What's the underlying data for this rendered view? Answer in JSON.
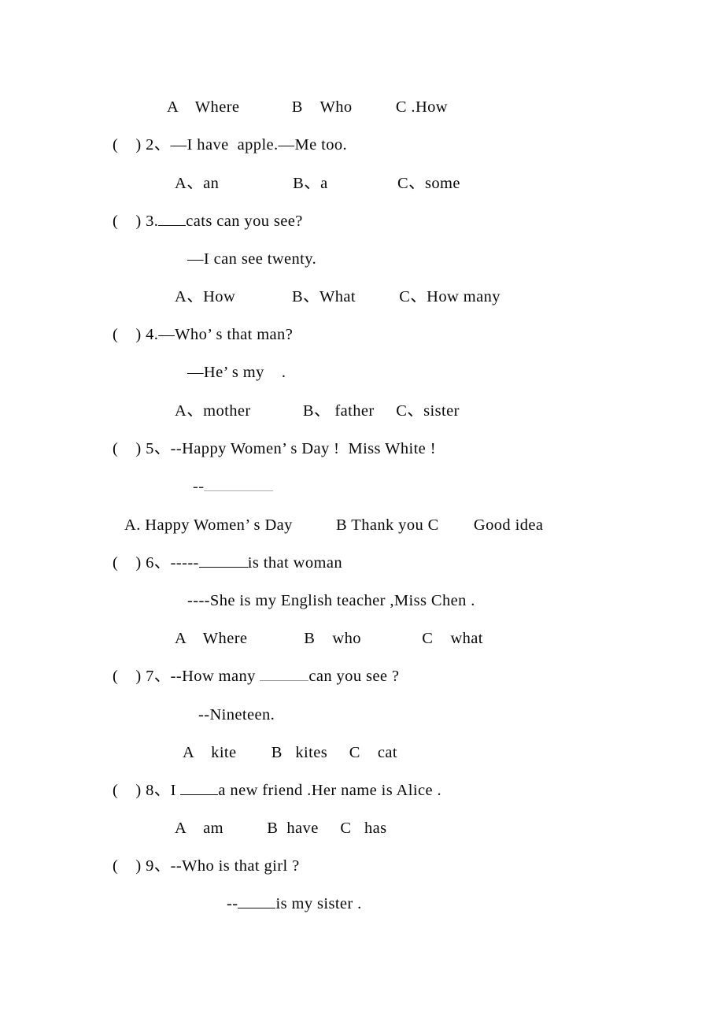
{
  "document": {
    "type": "english-multiple-choice-worksheet",
    "background_color": "#ffffff",
    "text_color": "#0a0a0a",
    "blank_dark_color": "#111111",
    "blank_grey_color": "#9a9a9a"
  },
  "lines": {
    "q1_options": "A    Where            B    Who          C .How",
    "q2_marker": "(    ) 2、",
    "q2_stem": "—I have  apple.—Me too.",
    "q2_options": "A、an                 B、a                C、some",
    "q3_marker": "(    ) 3.",
    "q3_stem_tail": "cats can you see?",
    "q3_answer": "—I can see twenty.",
    "q3_options": "A、How             B、What          C、How many",
    "q4_marker": "(    ) 4.",
    "q4_stem": "—Who’ s that man?",
    "q4_answer": "—He’ s my    .",
    "q4_options": "A、mother            B、 father     C、sister",
    "q5_marker": "(    ) 5、",
    "q5_stem": "--Happy Women’ s Day !  Miss White !",
    "q5_answer_prefix": "--",
    "q5_options": "A. Happy Women’ s Day          B Thank you C        Good idea",
    "q6_marker": "(    ) 6、",
    "q6_stem_prefix": "-----",
    "q6_stem_tail": "is that woman",
    "q6_answer": "----She is my English teacher ,Miss Chen .",
    "q6_options": "A    Where             B    who              C    what",
    "q7_marker": "(    ) 7、",
    "q7_stem_prefix": "--How many ",
    "q7_stem_tail": "can you see ?",
    "q7_answer": "--Nineteen.",
    "q7_options": "A    kite        B   kites     C    cat",
    "q8_marker": "(    ) 8、",
    "q8_stem_prefix": "I ",
    "q8_stem_tail": "a new friend .Her name is Alice .",
    "q8_options": "A    am          B  have     C   has",
    "q9_marker": "(    ) 9、",
    "q9_stem": "--Who is that girl ?",
    "q9_answer_prefix": "--",
    "q9_answer_tail": "is my sister ."
  }
}
